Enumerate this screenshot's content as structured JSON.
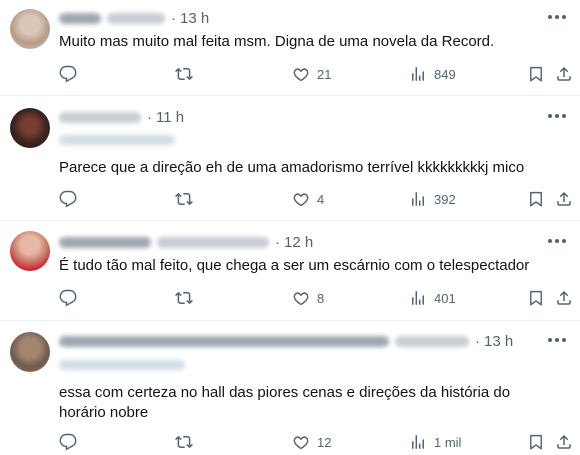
{
  "posts": [
    {
      "time": "13 h",
      "text": "Muito mas muito mal feita msm. Digna de uma novela da Record.",
      "replies": "",
      "reposts": "",
      "likes": "21",
      "views": "849"
    },
    {
      "time": "11 h",
      "text": "Parece que a direção eh de uma amadorismo terrível kkkkkkkkkj mico",
      "replies": "",
      "reposts": "",
      "likes": "4",
      "views": "392"
    },
    {
      "time": "12 h",
      "text": "É tudo tão mal feito, que chega a ser um escárnio com o telespectador",
      "replies": "",
      "reposts": "",
      "likes": "8",
      "views": "401"
    },
    {
      "time": "13 h",
      "text": "essa com certeza no hall das piores cenas e direções da história do horário nobre",
      "replies": "",
      "reposts": "",
      "likes": "12",
      "views": "1 mil"
    }
  ],
  "icons": {
    "reply": "reply-icon",
    "repost": "repost-icon",
    "like": "heart-icon",
    "views": "views-icon",
    "bookmark": "bookmark-icon",
    "share": "share-icon",
    "more": "more-icon"
  },
  "colors": {
    "text": "#0f1419",
    "secondary": "#536471",
    "divider": "#eff3f4"
  }
}
